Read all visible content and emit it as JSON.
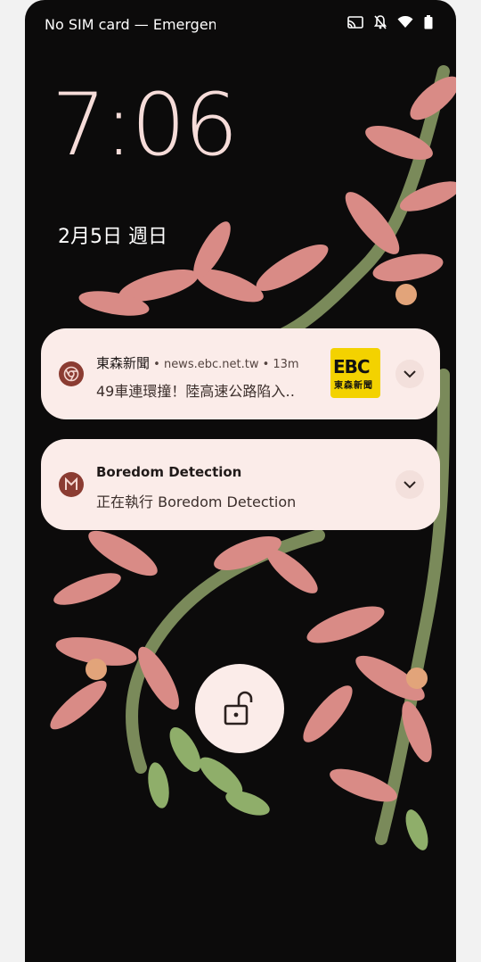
{
  "status_bar": {
    "carrier_text": "No SIM card — Emergency",
    "icons": [
      "cast-icon",
      "notifications-off-icon",
      "wifi-icon",
      "battery-icon"
    ]
  },
  "lockscreen": {
    "time": "7:06",
    "date": "2月5日 週日"
  },
  "notifications": [
    {
      "app_name": "東森新聞",
      "meta": " • news.ebc.net.tw • 13m",
      "text": "49車連環撞！陸高速公路陷入‥",
      "icon": "chrome-icon",
      "thumbnail": {
        "line1": "EBC",
        "line2": "東森新聞"
      }
    },
    {
      "app_name": "Boredom Detection",
      "text": "正在執行 Boredom Detection",
      "icon": "app-m-icon"
    }
  ],
  "colors": {
    "clock": "#f6dcd9",
    "card_bg": "#fbece9",
    "icon_bg": "#8b3c32",
    "thumb_bg": "#f3d200"
  }
}
